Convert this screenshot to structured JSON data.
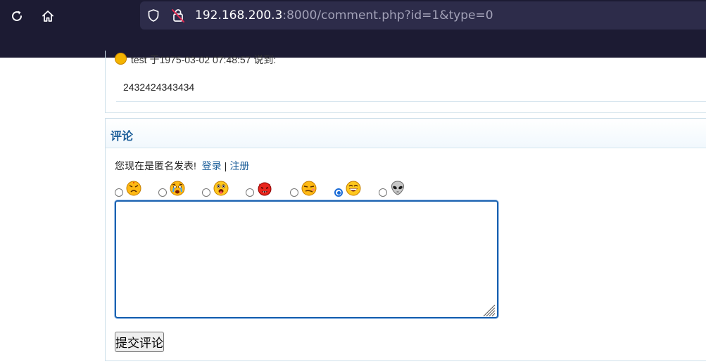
{
  "browser": {
    "url_host": "192.168.200.3",
    "url_rest": ":8000/comment.php?id=1&type=0"
  },
  "comment": {
    "meta": "test 于1975-03-02 07:48:57 说到:",
    "body": "2432424343434"
  },
  "form": {
    "title": "评论",
    "anon_text": "您现在是匿名发表!",
    "login_link": "登录",
    "separator": "|",
    "register_link": "注册",
    "emoticons": [
      {
        "icon": "angry-face-icon",
        "checked": false
      },
      {
        "icon": "crying-face-icon",
        "checked": false
      },
      {
        "icon": "tongue-face-icon",
        "checked": false
      },
      {
        "icon": "devil-face-icon",
        "checked": false
      },
      {
        "icon": "sneer-face-icon",
        "checked": false
      },
      {
        "icon": "grin-face-icon",
        "checked": true
      },
      {
        "icon": "alien-icon",
        "checked": false
      }
    ],
    "comment_value": "",
    "submit_label": "提交评论"
  }
}
